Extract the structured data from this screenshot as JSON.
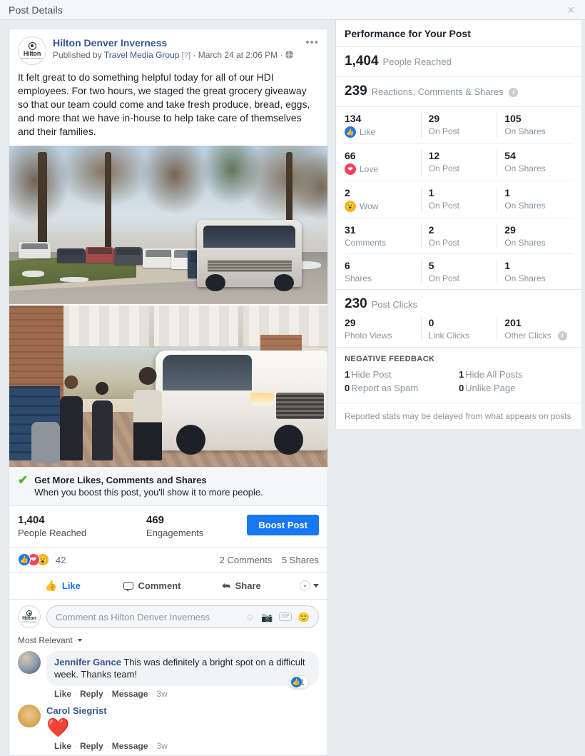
{
  "window": {
    "title": "Post Details",
    "close_label": "✕"
  },
  "post": {
    "page_name": "Hilton Denver Inverness",
    "published_prefix": "Published by",
    "publisher": "Travel Media Group",
    "publisher_marker": "[?]",
    "separator": "·",
    "timestamp": "March 24 at 2:06 PM",
    "privacy_icon": "globe-icon",
    "menu_icon": "ellipsis-icon",
    "body": "It felt great to do something helpful today for all of our HDI employees. For two hours, we staged the great grocery giveaway so that our team could come and take fresh produce, bread, eggs, and more that we have in-house to help take care of themselves and their families.",
    "avatar_brand": "Hilton",
    "avatar_sub": "DENVER INVERNESS",
    "photos": [
      {
        "alt": "Line of cars queued along a tree-lined street"
      },
      {
        "alt": "People handing out grocery bags beside a white pickup truck under a hotel portico"
      }
    ]
  },
  "boost": {
    "check_icon": "check-icon",
    "title": "Get More Likes, Comments and Shares",
    "subtitle": "When you boost this post, you'll show it to more people.",
    "reach_value": "1,404",
    "reach_label": "People Reached",
    "engagements_value": "469",
    "engagements_label": "Engagements",
    "button_label": "Boost Post"
  },
  "reactions_summary": {
    "count": "42",
    "comments": "2 Comments",
    "shares": "5 Shares",
    "icons": [
      "like-icon",
      "love-icon",
      "wow-icon"
    ]
  },
  "actions": {
    "like": "Like",
    "comment": "Comment",
    "share": "Share"
  },
  "composer": {
    "placeholder": "Comment as Hilton Denver Inverness",
    "icons": [
      "emoji-icon",
      "camera-icon",
      "gif-icon",
      "sticker-icon"
    ],
    "gif_label": "GIF"
  },
  "comments_sort": {
    "label": "Most Relevant"
  },
  "comments": [
    {
      "author": "Jennifer Gance",
      "text": "This was definitely a bright spot on a difficult week. Thanks team!",
      "emoji": "",
      "like": "Like",
      "reply": "Reply",
      "message": "Message",
      "time": "3w",
      "like_count": "1"
    },
    {
      "author": "Carol Siegrist",
      "text": "",
      "emoji": "❤️",
      "like": "Like",
      "reply": "Reply",
      "message": "Message",
      "time": "3w",
      "like_count": ""
    }
  ],
  "performance": {
    "title": "Performance for Your Post",
    "reach_value": "1,404",
    "reach_label": "People Reached",
    "engagement_value": "239",
    "engagement_label": "Reactions, Comments & Shares",
    "rows": [
      {
        "icon": "like-icon",
        "total": "134",
        "label": "Like",
        "on_post": "29",
        "on_post_label": "On Post",
        "on_shares": "105",
        "on_shares_label": "On Shares"
      },
      {
        "icon": "love-icon",
        "total": "66",
        "label": "Love",
        "on_post": "12",
        "on_post_label": "On Post",
        "on_shares": "54",
        "on_shares_label": "On Shares"
      },
      {
        "icon": "wow-icon",
        "total": "2",
        "label": "Wow",
        "on_post": "1",
        "on_post_label": "On Post",
        "on_shares": "1",
        "on_shares_label": "On Shares"
      },
      {
        "icon": "",
        "total": "31",
        "label": "Comments",
        "on_post": "2",
        "on_post_label": "On Post",
        "on_shares": "29",
        "on_shares_label": "On Shares"
      },
      {
        "icon": "",
        "total": "6",
        "label": "Shares",
        "on_post": "5",
        "on_post_label": "On Post",
        "on_shares": "1",
        "on_shares_label": "On Shares"
      }
    ],
    "clicks_value": "230",
    "clicks_label": "Post Clicks",
    "photo_views_value": "29",
    "photo_views_label": "Photo Views",
    "link_clicks_value": "0",
    "link_clicks_label": "Link Clicks",
    "other_clicks_value": "201",
    "other_clicks_label": "Other Clicks",
    "negative_title": "NEGATIVE FEEDBACK",
    "negative": [
      {
        "value": "1",
        "label": "Hide Post"
      },
      {
        "value": "1",
        "label": "Hide All Posts"
      },
      {
        "value": "0",
        "label": "Report as Spam"
      },
      {
        "value": "0",
        "label": "Unlike Page"
      }
    ],
    "footnote": "Reported stats may be delayed from what appears on posts"
  },
  "colors": {
    "facebook_blue": "#1877f2",
    "link_blue": "#365899",
    "love_red": "#f3425f",
    "wow_yellow": "#f7b125",
    "check_green": "#42b72a"
  }
}
